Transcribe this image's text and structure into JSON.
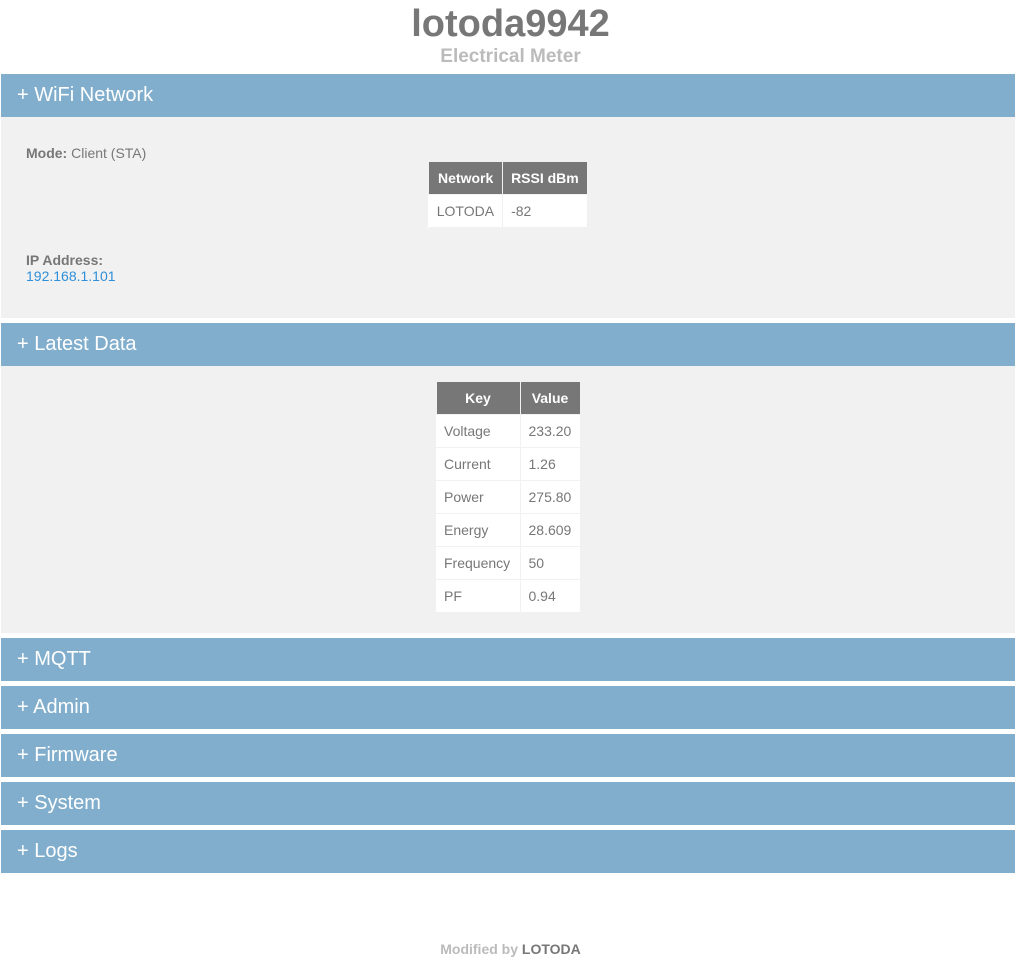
{
  "header": {
    "title": "lotoda9942",
    "subtitle": "Electrical Meter"
  },
  "wifi": {
    "bar_label": "+ WiFi Network",
    "mode_label": "Mode:",
    "mode_value": "Client (STA)",
    "table": {
      "headers": [
        "Network",
        "RSSI dBm"
      ],
      "rows": [
        [
          "LOTODA",
          "-82"
        ]
      ]
    },
    "ip_label": "IP Address:",
    "ip_value": "192.168.1.101"
  },
  "latest": {
    "bar_label": "+ Latest Data",
    "headers": [
      "Key",
      "Value"
    ],
    "rows": [
      [
        "Voltage",
        "233.20"
      ],
      [
        "Current",
        "1.26"
      ],
      [
        "Power",
        "275.80"
      ],
      [
        "Energy",
        "28.609"
      ],
      [
        "Frequency",
        "50"
      ],
      [
        "PF",
        "0.94"
      ]
    ]
  },
  "sections": [
    {
      "label": "+ MQTT"
    },
    {
      "label": "+ Admin"
    },
    {
      "label": "+ Firmware"
    },
    {
      "label": "+ System"
    },
    {
      "label": "+ Logs"
    }
  ],
  "footer": {
    "prefix": "Modified by",
    "brand": "LOTODA"
  },
  "colors": {
    "bar": "#81aecc",
    "panel": "#f1f1f1",
    "table_header": "#777777",
    "link": "#2f8fd8"
  }
}
